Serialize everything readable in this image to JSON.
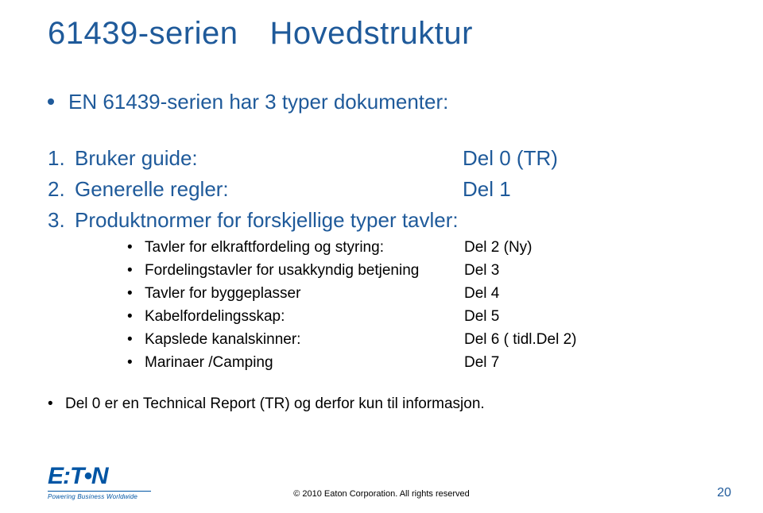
{
  "title": {
    "left": "61439-serien",
    "right": "Hovedstruktur"
  },
  "intro": "EN 61439-serien har 3 typer dokumenter:",
  "items": [
    {
      "num": "1.",
      "label": "Bruker guide:",
      "value": "Del 0 (TR)"
    },
    {
      "num": "2.",
      "label": "Generelle regler:",
      "value": "Del 1"
    },
    {
      "num": "3.",
      "label": "Produktnormer  for forskjellige typer tavler:",
      "value": ""
    }
  ],
  "subitems": [
    {
      "label": "Tavler for elkraftfordeling og styring:",
      "value": "Del 2   (Ny)"
    },
    {
      "label": "Fordelingstavler for usakkyndig betjening",
      "value": "Del 3"
    },
    {
      "label": "Tavler for byggeplasser",
      "value": "Del 4"
    },
    {
      "label": "Kabelfordelingsskap:",
      "value": "Del 5"
    },
    {
      "label": "Kapslede kanalskinner:",
      "value": "Del 6   ( tidl.Del 2)"
    },
    {
      "label": "Marinaer /Camping",
      "value": "Del 7"
    }
  ],
  "footnote": "Del 0 er en Technical Report (TR) og derfor kun til informasjon.",
  "footer": {
    "logo_main": "E:T•N",
    "logo_tag": "Powering Business Worldwide",
    "copyright": "© 2010 Eaton Corporation. All rights reserved",
    "page": "20"
  }
}
